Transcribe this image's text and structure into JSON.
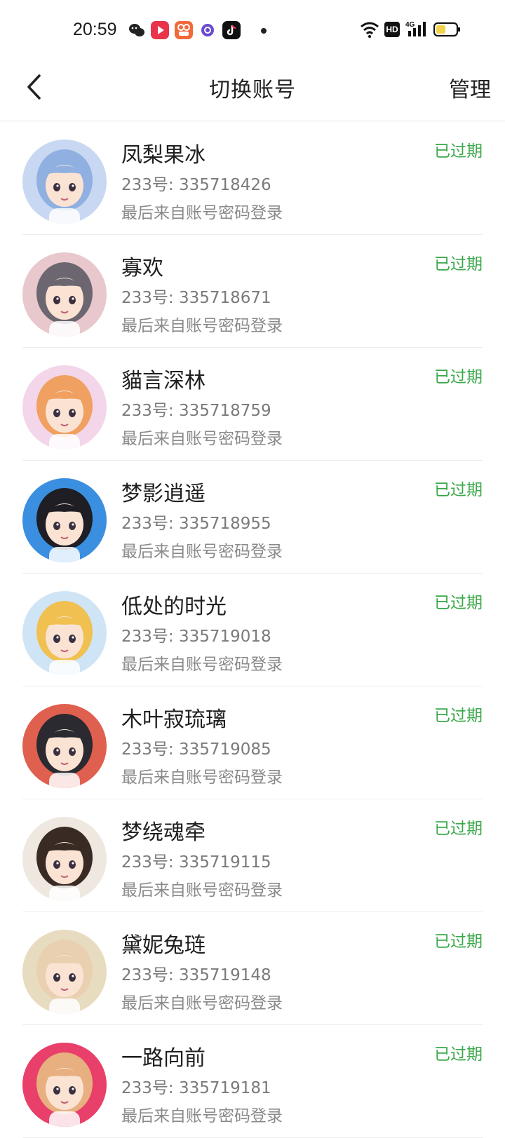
{
  "status_bar": {
    "time": "20:59",
    "apps": [
      "wechat-icon",
      "video-app-icon",
      "photo-app-icon",
      "browser-icon",
      "tiktok-icon"
    ],
    "system_icons": [
      "wifi-icon",
      "hd-icon",
      "signal-4g-icon",
      "battery-icon"
    ],
    "hd_label": "HD",
    "network_label": "4G"
  },
  "header": {
    "title": "切换账号",
    "manage_label": "管理"
  },
  "colors": {
    "accent_status": "#3aa84a",
    "text_primary": "#1f1f1f",
    "text_secondary": "#7a7a7a"
  },
  "accounts": [
    {
      "name": "凤梨果冰",
      "id_line": "233号: 335718426",
      "login_line": "最后来自账号密码登录",
      "status": "已过期",
      "avatar_bg": "#c9d8f2",
      "avatar_hair": "#8fb0e0"
    },
    {
      "name": "寡欢",
      "id_line": "233号: 335718671",
      "login_line": "最后来自账号密码登录",
      "status": "已过期",
      "avatar_bg": "#e8c8cc",
      "avatar_hair": "#6b6670"
    },
    {
      "name": "貓言深林",
      "id_line": "233号: 335718759",
      "login_line": "最后来自账号密码登录",
      "status": "已过期",
      "avatar_bg": "#f3d6ea",
      "avatar_hair": "#f0a060"
    },
    {
      "name": "梦影逍遥",
      "id_line": "233号: 335718955",
      "login_line": "最后来自账号密码登录",
      "status": "已过期",
      "avatar_bg": "#3b8fe0",
      "avatar_hair": "#1e1e24"
    },
    {
      "name": "低处的时光",
      "id_line": "233号: 335719018",
      "login_line": "最后来自账号密码登录",
      "status": "已过期",
      "avatar_bg": "#cfe4f5",
      "avatar_hair": "#f0c050"
    },
    {
      "name": "木叶寂琉璃",
      "id_line": "233号: 335719085",
      "login_line": "最后来自账号密码登录",
      "status": "已过期",
      "avatar_bg": "#e06050",
      "avatar_hair": "#2a2a30"
    },
    {
      "name": "梦绕魂牵",
      "id_line": "233号: 335719115",
      "login_line": "最后来自账号密码登录",
      "status": "已过期",
      "avatar_bg": "#eee8e0",
      "avatar_hair": "#3a2a24"
    },
    {
      "name": "黛妮兔琏",
      "id_line": "233号: 335719148",
      "login_line": "最后来自账号密码登录",
      "status": "已过期",
      "avatar_bg": "#e8dcc0",
      "avatar_hair": "#e8d0b0"
    },
    {
      "name": "一路向前",
      "id_line": "233号: 335719181",
      "login_line": "最后来自账号密码登录",
      "status": "已过期",
      "avatar_bg": "#e8406a",
      "avatar_hair": "#e8b080"
    }
  ]
}
